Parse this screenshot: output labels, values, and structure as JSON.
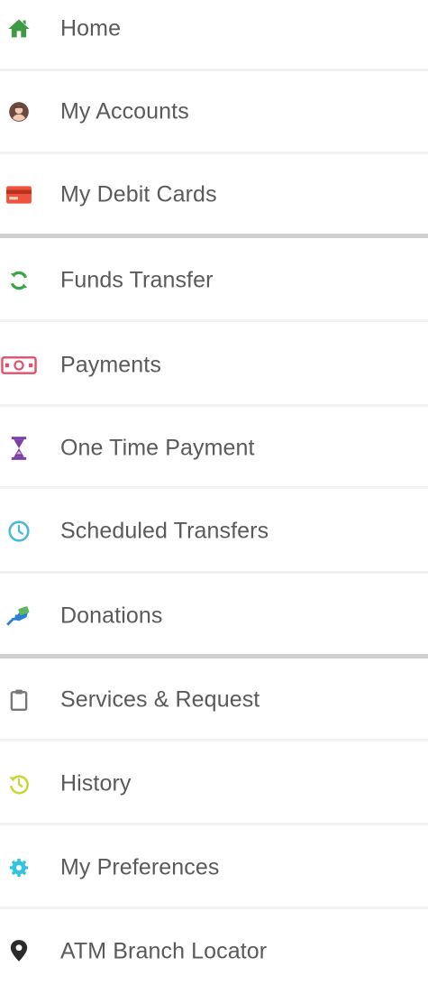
{
  "menu": {
    "items": [
      {
        "label": "Home",
        "icon": "home-icon",
        "color": "#3f9a45"
      },
      {
        "label": "My Accounts",
        "icon": "user-account-icon",
        "color": "#6b4a3e"
      },
      {
        "label": "My Debit Cards",
        "icon": "debit-card-icon",
        "color": "#f0533b"
      },
      {
        "label": "Funds Transfer",
        "icon": "transfer-arrows-icon",
        "color": "#3aa447"
      },
      {
        "label": "Payments",
        "icon": "payments-icon",
        "color": "#e0506c"
      },
      {
        "label": "One Time Payment",
        "icon": "hourglass-icon",
        "color": "#7b3fa8"
      },
      {
        "label": "Scheduled Transfers",
        "icon": "clock-icon",
        "color": "#4fb6dc"
      },
      {
        "label": "Donations",
        "icon": "donation-icon",
        "color": "#2a7fd6"
      },
      {
        "label": "Services & Request",
        "icon": "clipboard-icon",
        "color": "#777777"
      },
      {
        "label": "History",
        "icon": "history-icon",
        "color": "#c8d63a"
      },
      {
        "label": "My Preferences",
        "icon": "preferences-gear-icon",
        "color": "#2fc4e0"
      },
      {
        "label": "ATM Branch Locator",
        "icon": "map-pin-icon",
        "color": "#2b2b2b"
      }
    ]
  }
}
